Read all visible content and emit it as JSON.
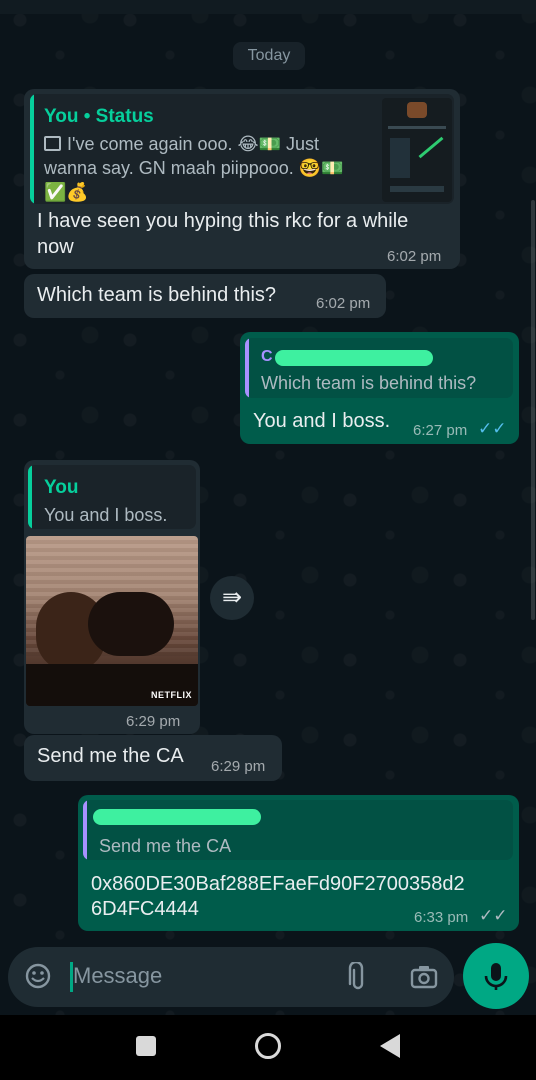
{
  "date_chip": "Today",
  "messages": [
    {
      "reply": {
        "author": "You • Status",
        "line1": "I've come again ooo. 😂💵 Just",
        "line2": "wanna say. GN maah piippooo. 🤓💵",
        "line3": "✅💰"
      },
      "text_line1": "I have seen you hyping this rkc for a while",
      "text_line2": "now",
      "time": "6:02 pm"
    },
    {
      "text": "Which team is behind this?",
      "time": "6:02 pm"
    },
    {
      "reply": {
        "author": "C",
        "text": "Which team is behind this?"
      },
      "text": "You and I boss.",
      "time": "6:27 pm",
      "ticks": "✓✓"
    },
    {
      "reply": {
        "author": "You",
        "text": "You and I boss."
      },
      "image_badge": "NETFLIX",
      "time": "6:29 pm"
    },
    {
      "text": "Send me the CA",
      "time": "6:29 pm"
    },
    {
      "reply": {
        "text": "Send me the CA"
      },
      "text_line1": "0x860DE30Baf288EFaeFd90F2700358d2",
      "text_line2": "6D4FC4444",
      "time": "6:33 pm",
      "ticks": "✓✓"
    }
  ],
  "input": {
    "placeholder": "Message"
  },
  "icons": {
    "emoji": "sticker-icon",
    "attach": "paperclip-icon",
    "camera": "camera-icon",
    "mic": "microphone-icon",
    "forward": "forward-icon",
    "nav_back": "back-triangle-icon",
    "nav_home": "home-circle-icon",
    "nav_recent": "recents-square-icon"
  },
  "colors": {
    "incoming": "#202c33",
    "outgoing": "#005c4b",
    "accent": "#00a884",
    "reply_author": "#06cf9c",
    "read_ticks": "#53bdeb"
  }
}
